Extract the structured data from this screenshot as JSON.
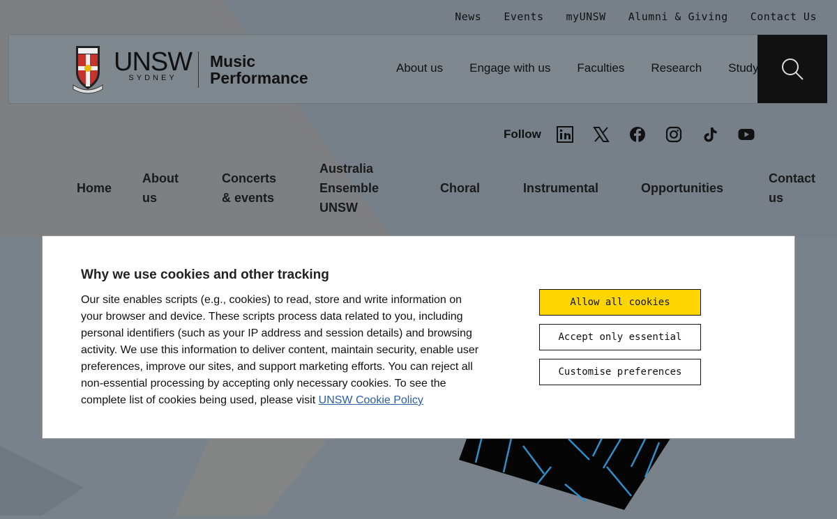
{
  "utility_nav": [
    "News",
    "Events",
    "myUNSW",
    "Alumni & Giving",
    "Contact Us"
  ],
  "brand": {
    "name": "UNSW",
    "location": "SYDNEY",
    "unit_line1": "Music",
    "unit_line2": "Performance"
  },
  "main_nav": [
    "About us",
    "Engage with us",
    "Faculties",
    "Research",
    "Study"
  ],
  "follow": {
    "label": "Follow",
    "icons": [
      "linkedin-icon",
      "x-icon",
      "facebook-icon",
      "instagram-icon",
      "tiktok-icon",
      "youtube-icon"
    ]
  },
  "sub_nav": [
    {
      "line1": "Home",
      "line2": "",
      "line3": ""
    },
    {
      "line1": "About",
      "line2": "us",
      "line3": ""
    },
    {
      "line1": "Concerts",
      "line2": "& events",
      "line3": ""
    },
    {
      "line1": "Australia",
      "line2": "Ensemble",
      "line3": "UNSW"
    },
    {
      "line1": "Choral",
      "line2": "",
      "line3": ""
    },
    {
      "line1": "Instrumental",
      "line2": "",
      "line3": ""
    },
    {
      "line1": "Opportunities",
      "line2": "",
      "line3": ""
    },
    {
      "line1": "Contact",
      "line2": "us",
      "line3": ""
    }
  ],
  "cookie": {
    "title": "Why we use cookies and other tracking",
    "body": "Our site enables scripts (e.g., cookies) to read, store and write information on your browser and device. These scripts process data related to you, including personal identifiers (such as your IP address and session details) and browsing activity. We use this information to deliver content, maintain security, enable user preferences, improve our sites, and support marketing efforts. You can reject all non-essential processing by accepting only necessary cookies. To see the complete list of cookies being used, please visit",
    "policy_link": "UNSW Cookie Policy",
    "allow_all": "Allow all cookies",
    "essential_only": "Accept only essential",
    "customise": "Customise preferences"
  },
  "colors": {
    "accent_yellow": "#ffd600",
    "link_blue": "#2b5ea8",
    "overlay": "#7b838a"
  }
}
